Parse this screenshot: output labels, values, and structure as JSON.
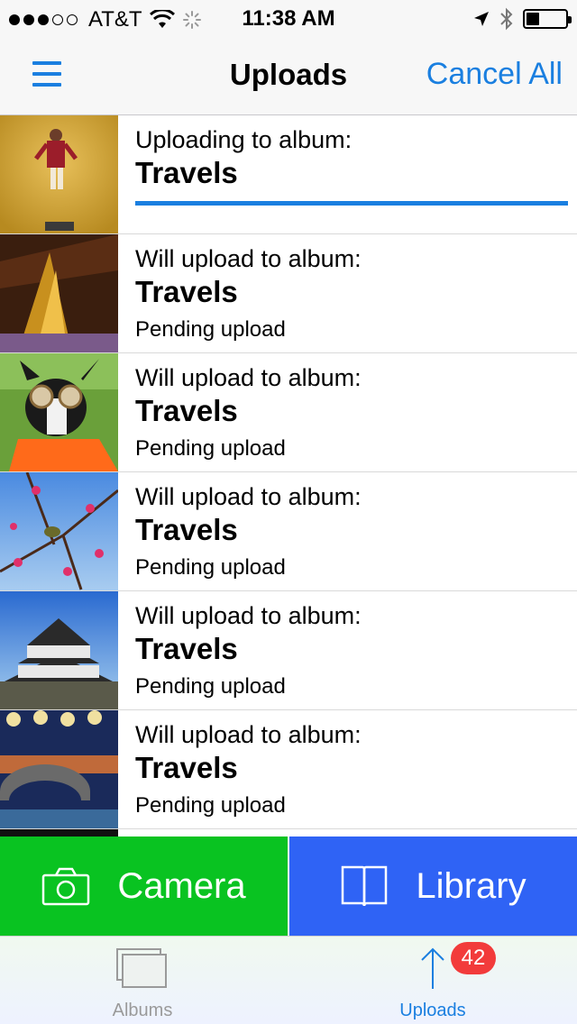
{
  "status_bar": {
    "carrier": "AT&T",
    "time": "11:38 AM",
    "signal_bars": 3,
    "battery_level": 0.3
  },
  "nav": {
    "title": "Uploads",
    "cancel_all_label": "Cancel All"
  },
  "uploads": {
    "items": [
      {
        "label": "Uploading to album:",
        "album": "Travels",
        "status": "",
        "progress": 1.0,
        "thumb": "man-dancing-photo"
      },
      {
        "label": "Will upload to album:",
        "album": "Travels",
        "status": "Pending upload",
        "thumb": "golden-buddha-photo"
      },
      {
        "label": "Will upload to album:",
        "album": "Travels",
        "status": "Pending upload",
        "thumb": "dog-goggles-photo"
      },
      {
        "label": "Will upload to album:",
        "album": "Travels",
        "status": "Pending upload",
        "thumb": "bird-blossom-photo"
      },
      {
        "label": "Will upload to album:",
        "album": "Travels",
        "status": "Pending upload",
        "thumb": "castle-photo"
      },
      {
        "label": "Will upload to album:",
        "album": "Travels",
        "status": "Pending upload",
        "thumb": "lantern-bridge-photo"
      }
    ]
  },
  "actions": {
    "camera_label": "Camera",
    "library_label": "Library"
  },
  "tabs": {
    "albums_label": "Albums",
    "uploads_label": "Uploads",
    "uploads_badge": "42"
  },
  "colors": {
    "accent": "#1a7fe0",
    "camera": "#09c321",
    "library": "#2f63f5",
    "badge": "#f23b3b"
  }
}
